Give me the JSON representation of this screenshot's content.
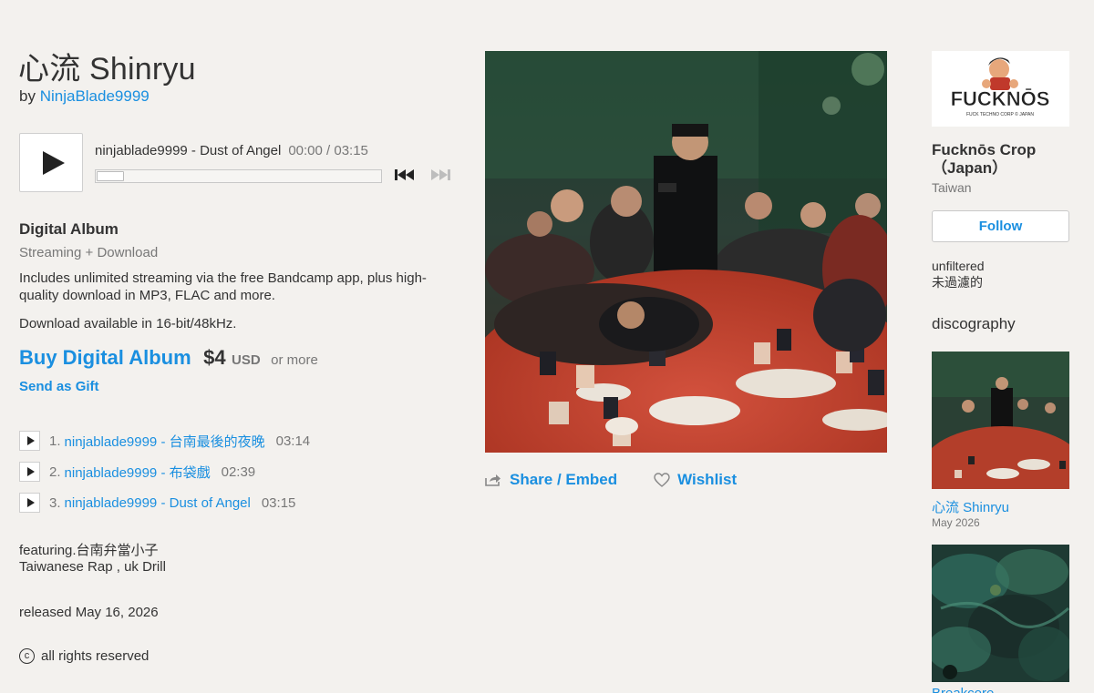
{
  "album": {
    "title": "心流 Shinryu",
    "by_prefix": "by",
    "artist": "NinjaBlade9999"
  },
  "player": {
    "now_playing": "ninjablade9999 - Dust of Angel",
    "time": "00:00 / 03:15",
    "progress": 0,
    "icons": [
      "play-icon",
      "prev-track-icon",
      "next-track-icon"
    ]
  },
  "package": {
    "title": "Digital Album",
    "subtitle": "Streaming + Download",
    "description": "Includes unlimited streaming via the free Bandcamp app, plus high-quality download in MP3, FLAC and more.",
    "download_note": "Download available in 16-bit/48kHz.",
    "buy_label": "Buy Digital Album",
    "price": "$4",
    "currency": "USD",
    "or_more": "or more",
    "gift_label": "Send as Gift"
  },
  "tracks": [
    {
      "num": "1.",
      "title": "ninjablade9999 - 台南最後的夜晚",
      "duration": "03:14"
    },
    {
      "num": "2.",
      "title": "ninjablade9999 - 布袋戲",
      "duration": "02:39"
    },
    {
      "num": "3.",
      "title": "ninjablade9999 - Dust of Angel",
      "duration": "03:15"
    }
  ],
  "about": {
    "line1": "featuring.台南弁當小子",
    "line2": "Taiwanese Rap , uk Drill"
  },
  "released": "released May 16, 2026",
  "rights": {
    "symbol": "c",
    "text": "all rights reserved"
  },
  "actions": {
    "share": "Share / Embed",
    "wishlist": "Wishlist"
  },
  "label": {
    "logo_text": "FUCKNŌS",
    "logo_subtext": "FUCK TECHNO CORP © JAPAN",
    "name": "Fucknōs Crop （Japan）",
    "location": "Taiwan",
    "follow": "Follow",
    "bio_line1": "unfiltered",
    "bio_line2": "未過濾的"
  },
  "discography": {
    "heading": "discography",
    "items": [
      {
        "title": "心流 Shinryu",
        "date": "May 2026"
      },
      {
        "title": "Breakcore..."
      }
    ]
  },
  "colors": {
    "background": "#f3f1ee",
    "link": "#1a8fe0",
    "text": "#333333",
    "muted": "#777777"
  }
}
